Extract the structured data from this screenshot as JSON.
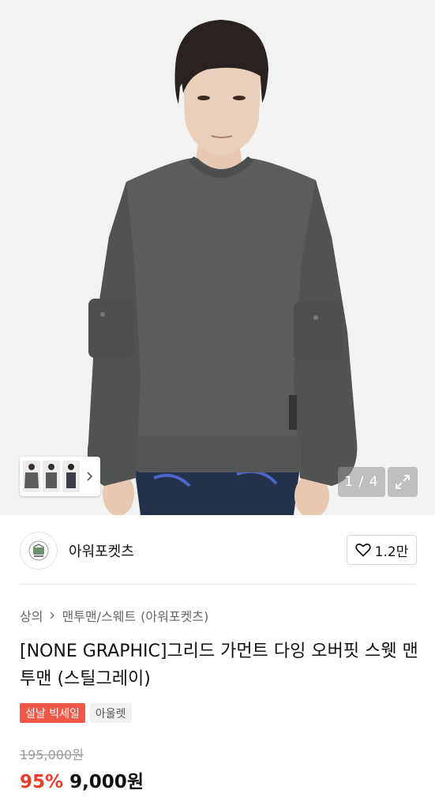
{
  "gallery": {
    "counter": "1 / 4",
    "thumbnails": [
      "thumb-front",
      "thumb-side",
      "thumb-back"
    ],
    "icons": {
      "next": "chevron-right-icon",
      "expand": "expand-icon"
    }
  },
  "brand": {
    "name": "아워포켓츠",
    "likes": "1.2만",
    "logo_icon": "brand-logo-icon",
    "like_icon": "heart-icon"
  },
  "breadcrumb": {
    "category": "상의",
    "subcategory": "맨투맨/스웨트",
    "brand": "(아워포켓츠)"
  },
  "product": {
    "title": "[NONE GRAPHIC]그리드 가먼트 다잉 오버핏 스웻 맨투맨 (스틸그레이)",
    "badges": [
      "설날 빅세일",
      "아울렛"
    ],
    "original_price": "195,000원",
    "discount": "95%",
    "price": "9,000원"
  },
  "colors": {
    "sale_badge": "#f15746",
    "discount_text": "#ef3b2c",
    "sweatshirt": "#565957"
  }
}
